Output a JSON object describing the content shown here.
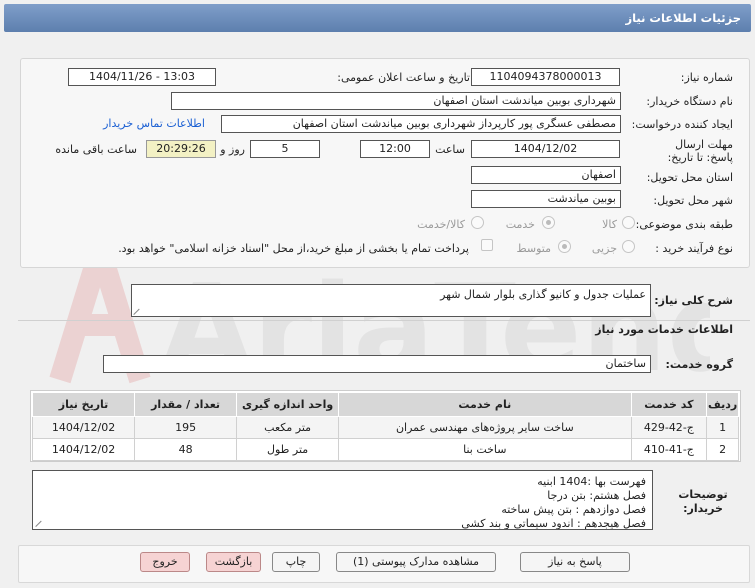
{
  "title": "جزئیات اطلاعات نیاز",
  "fields": {
    "need_number_label": "شماره نیاز:",
    "need_number": "1104094378000013",
    "announce_label": "تاریخ و ساعت اعلان عمومی:",
    "announce_value": "1404/11/26 - 13:03",
    "buyer_org_label": "نام دستگاه خریدار:",
    "buyer_org": "شهرداری بوبین میاندشت استان اصفهان",
    "requester_label": "ایجاد کننده درخواست:",
    "requester": "مصطفی عسگری پور کارپرداز شهرداری بوبین میاندشت استان اصفهان",
    "buyer_contact_link": "اطلاعات تماس خریدار",
    "deadline_label": "مهلت ارسال پاسخ: تا تاریخ:",
    "deadline_date": "1404/12/02",
    "time_label": "ساعت",
    "deadline_time": "12:00",
    "days_value": "5",
    "days_label": "روز و",
    "remaining_time": "20:29:26",
    "remaining_label": "ساعت باقی مانده",
    "province_label": "استان محل تحویل:",
    "province": "اصفهان",
    "city_label": "شهر محل تحویل:",
    "city": "بوبین میاندشت",
    "category_label": "طبقه بندی موضوعی:",
    "category_options": [
      "کالا",
      "خدمت",
      "کالا/خدمت"
    ],
    "process_label": "نوع فرآیند خرید :",
    "process_options": [
      "جزیی",
      "متوسط"
    ],
    "payment_note": "پرداخت تمام یا بخشی از مبلغ خرید،از محل \"اسناد خزانه اسلامی\" خواهد بود."
  },
  "description": {
    "label": "شرح کلی نیاز:",
    "value": "عملیات جدول و کانیو گذاری بلوار شمال شهر"
  },
  "services": {
    "heading": "اطلاعات خدمات مورد نیاز",
    "group_label": "گروه خدمت:",
    "group_value": "ساختمان"
  },
  "table": {
    "headers": [
      "ردیف",
      "کد خدمت",
      "نام خدمت",
      "واحد اندازه گیری",
      "تعداد / مقدار",
      "تاریخ نیاز"
    ],
    "rows": [
      [
        "1",
        "ج-42-429",
        "ساخت سایر پروژه‌های مهندسی عمران",
        "متر مکعب",
        "195",
        "1404/12/02"
      ],
      [
        "2",
        "ج-41-410",
        "ساخت بنا",
        "متر طول",
        "48",
        "1404/12/02"
      ]
    ]
  },
  "buyer_notes": {
    "label": "توضیحات خریدار:",
    "lines": [
      "فهرست بها :1404 ابنیه",
      "فصل هشتم: بتن درجا",
      "فصل دوازدهم : بتن پیش ساخته",
      "فصل هیجدهم : اندود سیماتی  و بند کشی"
    ]
  },
  "buttons": {
    "respond": "پاسخ به نیاز",
    "attachments": "مشاهده مدارک پیوستی (1)",
    "print": "چاپ",
    "back": "بازگشت",
    "exit": "خروج"
  },
  "watermark": "AriaTender.net",
  "colors": {
    "title_bar": "#6b8cbb",
    "link": "#1a5fd3",
    "exit_button": "#f6d3d3",
    "time_box": "#f3f1c4"
  }
}
